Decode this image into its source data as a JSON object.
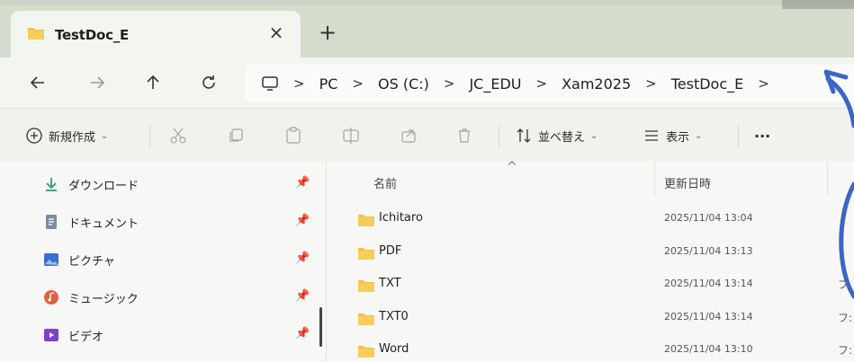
{
  "tab": {
    "title": "TestDoc_E",
    "close_label": "×",
    "new_tab_label": "+"
  },
  "nav": {
    "back_icon": "arrow-left-icon",
    "forward_icon": "arrow-right-icon",
    "up_icon": "arrow-up-icon",
    "refresh_icon": "refresh-icon"
  },
  "breadcrumb": {
    "items": [
      "PC",
      "OS (C:)",
      "JC_EDU",
      "Xam2025",
      "TestDoc_E"
    ],
    "separator": ">"
  },
  "commands": {
    "new_label": "新規作成",
    "sort_label": "並べ替え",
    "view_label": "表示",
    "more_label": "···",
    "caret": "⌄"
  },
  "sidebar": {
    "items": [
      {
        "label": "ダウンロード",
        "icon": "download-icon"
      },
      {
        "label": "ドキュメント",
        "icon": "document-icon"
      },
      {
        "label": "ピクチャ",
        "icon": "picture-icon"
      },
      {
        "label": "ミュージック",
        "icon": "music-icon"
      },
      {
        "label": "ビデオ",
        "icon": "video-icon"
      }
    ],
    "pin_glyph": "📌"
  },
  "filelist": {
    "headers": {
      "name": "名前",
      "modified": "更新日時"
    },
    "sort_caret": "^",
    "rows": [
      {
        "name": "Ichitaro",
        "date": "2025/11/04 13:04",
        "type": ""
      },
      {
        "name": "PDF",
        "date": "2025/11/04 13:13",
        "type": ""
      },
      {
        "name": "TXT",
        "date": "2025/11/04 13:14",
        "type": "フ"
      },
      {
        "name": "TXT0",
        "date": "2025/11/04 13:14",
        "type": "フ:"
      },
      {
        "name": "Word",
        "date": "2025/11/04 13:10",
        "type": "フ:"
      }
    ]
  },
  "colors": {
    "accent": "#3a63b8",
    "folder": "#f2c04a",
    "annotation": "#3b66c4"
  }
}
